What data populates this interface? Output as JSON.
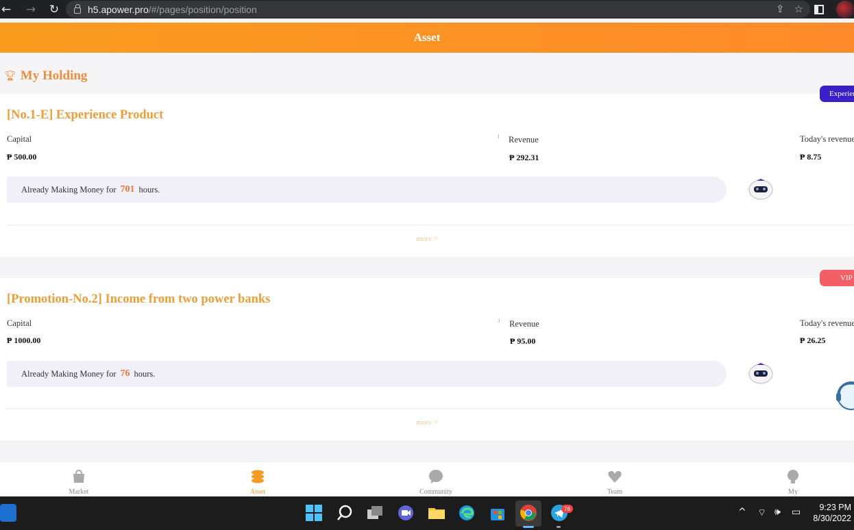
{
  "browser": {
    "back_icon": "back-arrow-icon",
    "url_host": "h5.apower.pro",
    "url_path": "/#/pages/position/position"
  },
  "header": {
    "title": "Asset"
  },
  "section": {
    "title": "My Holding"
  },
  "holdings": [
    {
      "title": "[No.1-E] Experience Product",
      "badge": "Experience",
      "capital_label": "Capital",
      "capital_value": "₱ 500.00",
      "revenue_label": "Revenue",
      "revenue_value": "₱ 292.31",
      "today_label": "Today's revenue",
      "today_value": "₱ 8.75",
      "making_prefix": "Already Making Money for",
      "hours": "701",
      "hours_suffix": "hours.",
      "more": "more >"
    },
    {
      "title": "[Promotion-No.2] Income from two power banks",
      "badge": "VIP",
      "capital_label": "Capital",
      "capital_value": "₱ 1000.00",
      "revenue_label": "Revenue",
      "revenue_value": "₱ 95.00",
      "today_label": "Today's revenue",
      "today_value": "₱ 26.25",
      "making_prefix": "Already Making Money for",
      "hours": "76",
      "hours_suffix": "hours.",
      "more": "more >"
    }
  ],
  "tabs": [
    {
      "label": "Market",
      "icon": "bag-icon"
    },
    {
      "label": "Asset",
      "icon": "coins-icon",
      "active": true
    },
    {
      "label": "Community",
      "icon": "chat-bubble-icon"
    },
    {
      "label": "Team",
      "icon": "heart-hands-icon"
    },
    {
      "label": "My",
      "icon": "user-icon"
    }
  ],
  "taskbar": {
    "time": "9:23 PM",
    "date": "8/30/2022",
    "telegram_badge": "76"
  },
  "colors": {
    "accent": "#fb9c1f",
    "title": "#eb9e3a",
    "hours": "#f0733a",
    "badge_experience": "#3b20c8",
    "badge_vip": "#f35f66"
  }
}
